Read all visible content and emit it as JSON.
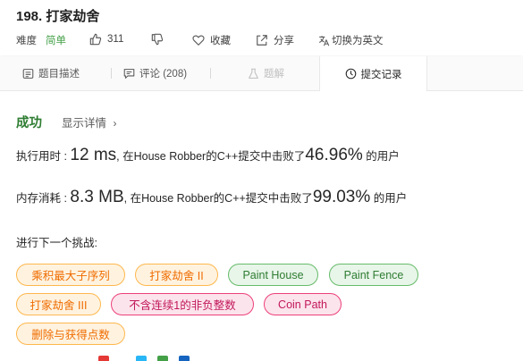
{
  "problem": {
    "title": "198. 打家劫舍"
  },
  "meta": {
    "difficulty_label": "难度",
    "difficulty_value": "简单",
    "likes": "311",
    "favorite_label": "收藏",
    "share_label": "分享",
    "switch_lang_label": "切换为英文"
  },
  "tabs": {
    "description": "题目描述",
    "comments": "评论 (208)",
    "solution": "题解",
    "submissions": "提交记录"
  },
  "result": {
    "status": "成功",
    "show_detail": "显示详情",
    "runtime_label": "执行用时 : ",
    "runtime_value": "12 ms",
    "runtime_text": ", 在House Robber的C++提交中击败了",
    "runtime_percent": "46.96%",
    "runtime_suffix": " 的用户",
    "memory_label": "内存消耗 : ",
    "memory_value": "8.3 MB",
    "memory_text": ", 在House Robber的C++提交中击败了",
    "memory_percent": "99.03%",
    "memory_suffix": " 的用户"
  },
  "next": {
    "label": "进行下一个挑战:",
    "challenges": [
      {
        "label": "乘积最大子序列",
        "difficulty": "medium"
      },
      {
        "label": "打家劫舍 II",
        "difficulty": "medium"
      },
      {
        "label": "Paint House",
        "difficulty": "easy"
      },
      {
        "label": "Paint Fence",
        "difficulty": "easy"
      },
      {
        "label": "打家劫舍 III",
        "difficulty": "medium"
      },
      {
        "label": "不含连续1的非负整数",
        "difficulty": "hard"
      },
      {
        "label": "Coin Path",
        "difficulty": "hard"
      },
      {
        "label": "删除与获得点数",
        "difficulty": "medium"
      }
    ]
  },
  "colors": {
    "success": "#2e7d32",
    "easy": "#43a047",
    "medium_tag": "#ef6c00",
    "hard_tag": "#c2185b",
    "share_icons": [
      "#e53935",
      "#29b6f6",
      "#43a047",
      "#1565c0"
    ]
  },
  "icons": {
    "like": "thumbs-up-icon",
    "dislike": "thumbs-down-icon",
    "favorite": "heart-icon",
    "share": "share-icon",
    "translate": "translate-icon",
    "description_tab": "document-icon",
    "comments_tab": "comment-icon",
    "solution_tab": "flask-icon",
    "submissions_tab": "clock-icon",
    "detail": "chevron-right-icon"
  }
}
